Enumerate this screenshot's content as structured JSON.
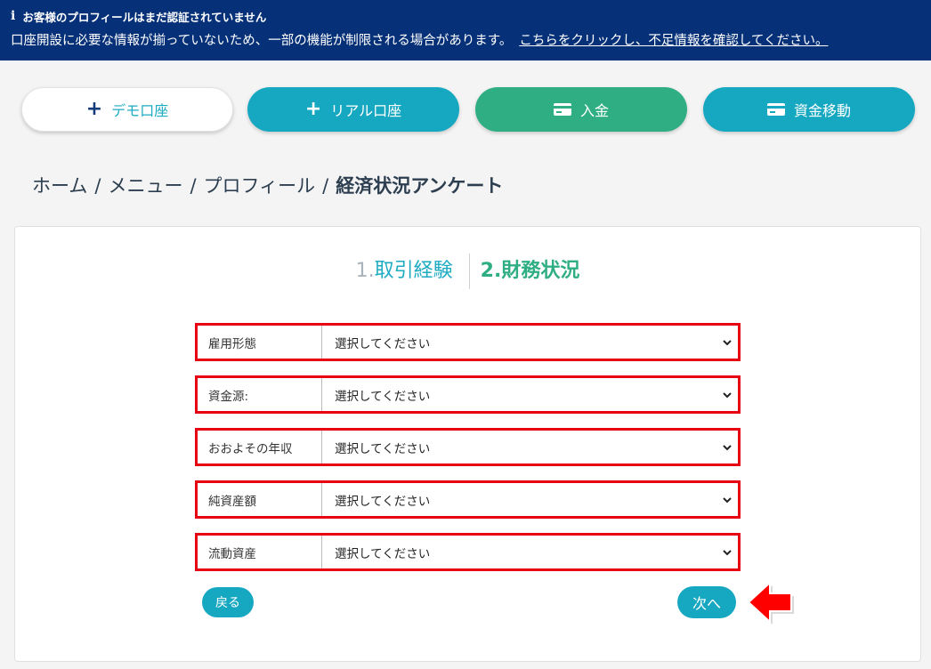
{
  "banner": {
    "title": "お客様のプロフィールはまだ認証されていません",
    "message": "口座開設に必要な情報が揃っていないため、一部の機能が制限される場合があります。",
    "link": "こちらをクリックし、不足情報を確認してください。",
    "icon": "info-icon"
  },
  "actions": {
    "demo": "デモ口座",
    "real": "リアル口座",
    "deposit": "入金",
    "transfer": "資金移動"
  },
  "breadcrumb": {
    "items": [
      "ホーム",
      "メニュー",
      "プロフィール"
    ],
    "current": "経済状況アンケート"
  },
  "steps": {
    "step1_num": "1.",
    "step1_label": "取引経験",
    "step2": "2.財務状況"
  },
  "fields": [
    {
      "label": "雇用形態",
      "value": "選択してください"
    },
    {
      "label": "資金源:",
      "value": "選択してください"
    },
    {
      "label": "おおよその年収",
      "value": "選択してください"
    },
    {
      "label": "純資産額",
      "value": "選択してください"
    },
    {
      "label": "流動資産",
      "value": "選択してください"
    }
  ],
  "buttons": {
    "back": "戻る",
    "next": "次へ"
  },
  "colors": {
    "banner": "#063178",
    "teal": "#17a8c1",
    "green": "#2fae84",
    "highlight": "#e60012"
  }
}
